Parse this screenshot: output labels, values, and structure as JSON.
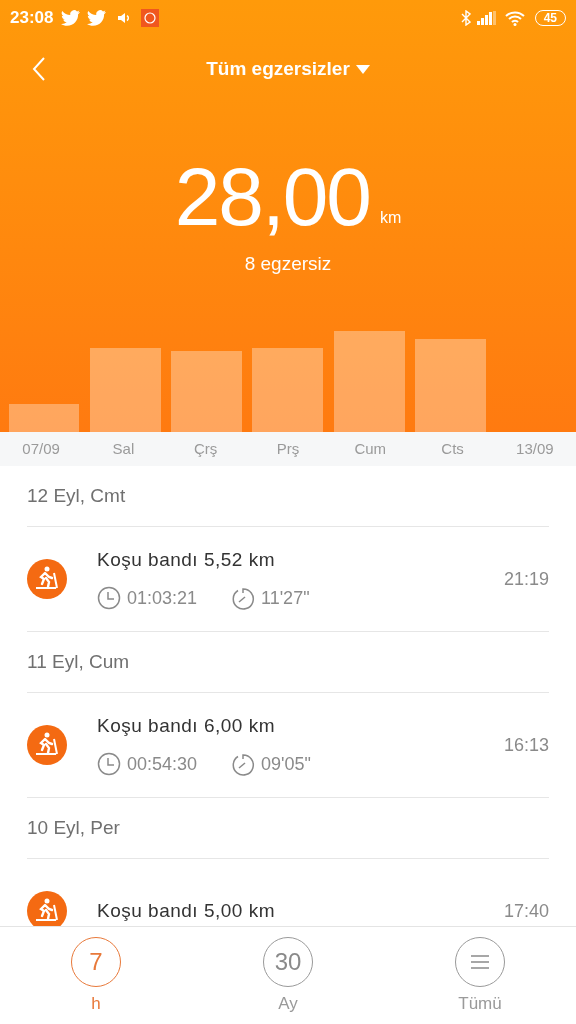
{
  "status_bar": {
    "time": "23:08",
    "battery": "45"
  },
  "header": {
    "title": "Tüm egzersizler",
    "total": "28,00",
    "unit": "km",
    "count": "8 egzersiz"
  },
  "week_labels": [
    "07/09",
    "Sal",
    "Çrş",
    "Prş",
    "Cum",
    "Cts",
    "13/09"
  ],
  "days": [
    {
      "date": "12 Eyl, Cmt",
      "workouts": [
        {
          "title": "Koşu bandı 5,52 km",
          "duration": "01:03:21",
          "pace": "11'27\"",
          "time": "21:19"
        }
      ]
    },
    {
      "date": "11 Eyl, Cum",
      "workouts": [
        {
          "title": "Koşu bandı 6,00 km",
          "duration": "00:54:30",
          "pace": "09'05\"",
          "time": "16:13"
        }
      ]
    },
    {
      "date": "10 Eyl, Per",
      "workouts": [
        {
          "title": "Koşu bandı 5,00 km",
          "time": "17:40"
        }
      ]
    }
  ],
  "tabs": [
    {
      "number": "7",
      "label": "h",
      "selected": true,
      "kind": "text"
    },
    {
      "number": "30",
      "label": "Ay",
      "selected": false,
      "kind": "text"
    },
    {
      "label": "Tümü",
      "selected": false,
      "kind": "menu"
    }
  ]
}
